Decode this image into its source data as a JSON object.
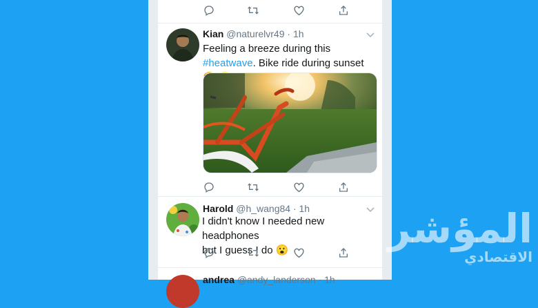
{
  "tweets": [
    {
      "name": "Kian",
      "handle": "@naturelvr49",
      "time": "1h",
      "text_before": "Feeling a breeze during this",
      "hashtag": "#heatwave",
      "text_after": ". Bike ride during sunset 😍 🌝"
    },
    {
      "name": "Harold",
      "handle": "@h_wang84",
      "time": "1h",
      "line1": "I didn't know I needed new headphones",
      "line2": "but I guess I do 😮"
    },
    {
      "name": "andrea",
      "handle": "@andy_landerson",
      "time": "1h"
    }
  ],
  "separator": "·",
  "watermark": {
    "line1": "المؤشر",
    "line2": "الاقتصادي"
  },
  "colors": {
    "background": "#1da1f2",
    "accent": "#1da1f2",
    "text": "#14171a",
    "muted": "#657786"
  },
  "icons": [
    "reply-icon",
    "retweet-icon",
    "like-icon",
    "share-icon",
    "chevron-down-icon"
  ]
}
